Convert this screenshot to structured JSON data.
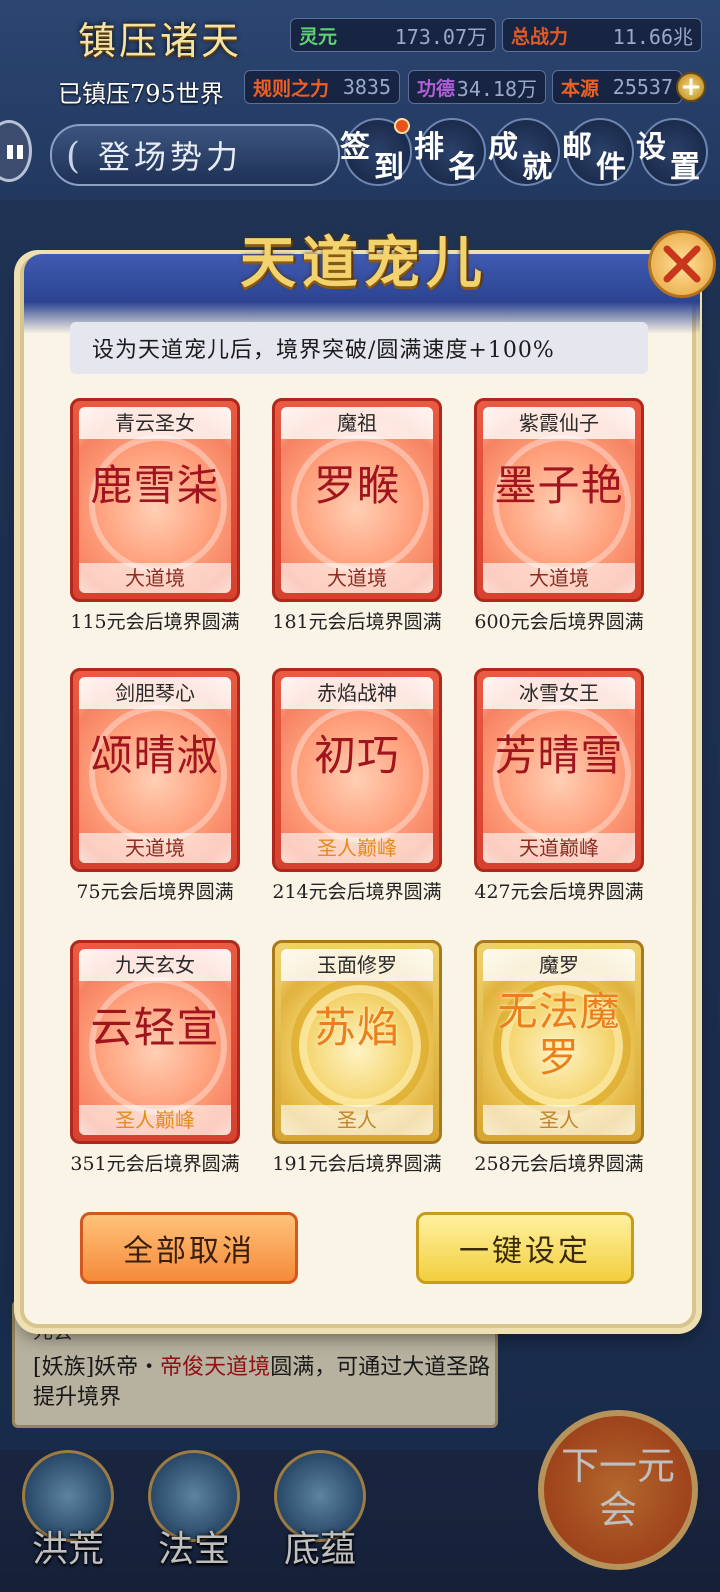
{
  "hud": {
    "world_name": "镇压诸天",
    "suppressed_worlds": "已镇压795世界",
    "lingyuan_label": "灵元",
    "lingyuan_value": "173.07万",
    "total_power_label": "总战力",
    "total_power_value": "11.66兆",
    "rule_power_label": "规则之力",
    "rule_power_value": "3835",
    "merit_label": "功德",
    "merit_value": "34.18万",
    "origin_label": "本源",
    "origin_value": "25537",
    "faction_button": "登场势力",
    "menu": [
      {
        "a": "签",
        "b": "到",
        "badge": true
      },
      {
        "a": "排",
        "b": "名",
        "badge": false
      },
      {
        "a": "成",
        "b": "就",
        "badge": false
      },
      {
        "a": "邮",
        "b": "件",
        "badge": false
      },
      {
        "a": "设",
        "b": "置",
        "badge": false
      }
    ]
  },
  "modal": {
    "title": "天道宠儿",
    "banner": "设为天道宠儿后，境界突破/圆满速度+100%",
    "cards": [
      {
        "title": "青云圣女",
        "name": "鹿雪柒",
        "realm": "大道境",
        "caption": "115元会后境界圆满",
        "style": "red"
      },
      {
        "title": "魔祖",
        "name": "罗睺",
        "realm": "大道境",
        "caption": "181元会后境界圆满",
        "style": "red"
      },
      {
        "title": "紫霞仙子",
        "name": "墨子艳",
        "realm": "大道境",
        "caption": "600元会后境界圆满",
        "style": "red"
      },
      {
        "title": "剑胆琴心",
        "name": "颂晴淑",
        "realm": "天道境",
        "caption": "75元会后境界圆满",
        "style": "red"
      },
      {
        "title": "赤焰战神",
        "name": "初巧",
        "realm": "圣人巅峰",
        "caption": "214元会后境界圆满",
        "style": "red"
      },
      {
        "title": "冰雪女王",
        "name": "芳晴雪",
        "realm": "天道巅峰",
        "caption": "427元会后境界圆满",
        "style": "red"
      },
      {
        "title": "九天玄女",
        "name": "云轻宣",
        "realm": "圣人巅峰",
        "caption": "351元会后境界圆满",
        "style": "red"
      },
      {
        "title": "玉面修罗",
        "name": "苏焰",
        "realm": "圣人",
        "caption": "191元会后境界圆满",
        "style": "gold"
      },
      {
        "title": "魔罗",
        "name": "无法魔罗",
        "realm": "圣人",
        "caption": "258元会后境界圆满",
        "style": "gold"
      }
    ],
    "cancel_all": "全部取消",
    "one_key_set": "一键设定"
  },
  "background": {
    "prev_line": "元会",
    "log_prefix": "[妖族]妖帝・",
    "log_highlight": "帝俊天道境",
    "log_suffix": "圆满，可通过大道圣路提升境界",
    "next_button": "下一元会",
    "nav": [
      "洪荒",
      "法宝",
      "底蕴"
    ]
  },
  "colors": {
    "accent_gold": "#f3d36d",
    "card_red": "#e95b42",
    "card_gold": "#efd16a",
    "highlight_red": "#c0151a"
  }
}
